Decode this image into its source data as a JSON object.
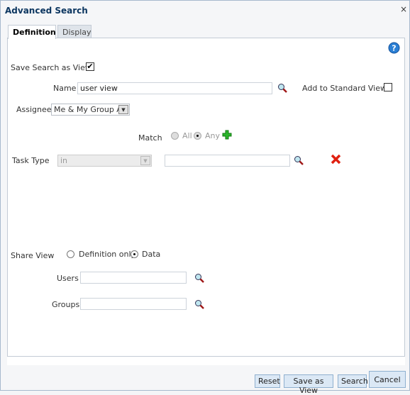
{
  "dialog": {
    "title": "Advanced Search",
    "close_label": "×"
  },
  "tabs": [
    {
      "label": "Definition",
      "active": true
    },
    {
      "label": "Display",
      "active": false
    }
  ],
  "definition": {
    "save_search_as_view": {
      "label": "Save Search as View",
      "checked": true
    },
    "name": {
      "label": "Name",
      "value": "user view"
    },
    "add_to_standard_views": {
      "label": "Add to Standard Views",
      "checked": false
    },
    "assignee": {
      "label": "Assignee",
      "value": "Me & My Group All"
    },
    "match": {
      "label": "Match",
      "options": [
        "All",
        "Any"
      ],
      "selected": "Any"
    },
    "task_type": {
      "label": "Task Type",
      "operator": "in",
      "value": ""
    },
    "share_view": {
      "label": "Share View",
      "options": [
        "Definition only",
        "Data"
      ],
      "selected": "Data"
    },
    "users": {
      "label": "Users",
      "value": ""
    },
    "groups": {
      "label": "Groups",
      "value": ""
    }
  },
  "buttons": {
    "reset": "Reset",
    "save_as_view": "Save as View",
    "search": "Search",
    "cancel": "Cancel"
  },
  "colors": {
    "title": "#0c3660",
    "button_bg": "#dbe8f5",
    "remove": "#e02010",
    "add": "#22aa22",
    "help": "#2a7fd4"
  }
}
